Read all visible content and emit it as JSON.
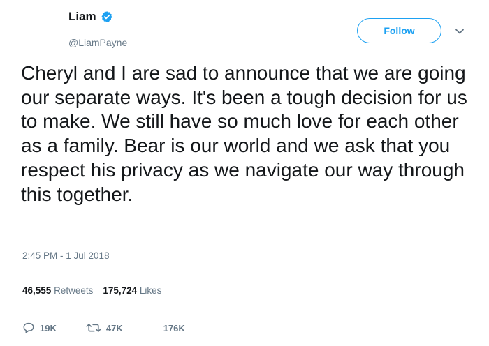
{
  "user": {
    "display_name": "Liam",
    "handle": "@LiamPayne",
    "verified_icon": "verified-badge-icon"
  },
  "header": {
    "follow_label": "Follow",
    "menu_icon": "chevron-down-icon"
  },
  "tweet": {
    "text": "Cheryl and I are sad to announce that we are going our separate ways. It's been a tough decision for us to make. We still have so much love for each other as a family. Bear is our world and we ask that you respect his privacy as we navigate our way through this together.",
    "timestamp": "2:45 PM - 1 Jul 2018"
  },
  "stats": {
    "retweets_count": "46,555",
    "retweets_label": "Retweets",
    "likes_count": "175,724",
    "likes_label": "Likes"
  },
  "actions": {
    "reply_count": "19K",
    "retweet_count": "47K",
    "like_count": "176K",
    "reply_icon": "reply-icon",
    "retweet_icon": "retweet-icon"
  },
  "colors": {
    "accent": "#1da1f2",
    "text": "#14171a",
    "secondary": "#657786",
    "divider": "#e6ecf0"
  }
}
